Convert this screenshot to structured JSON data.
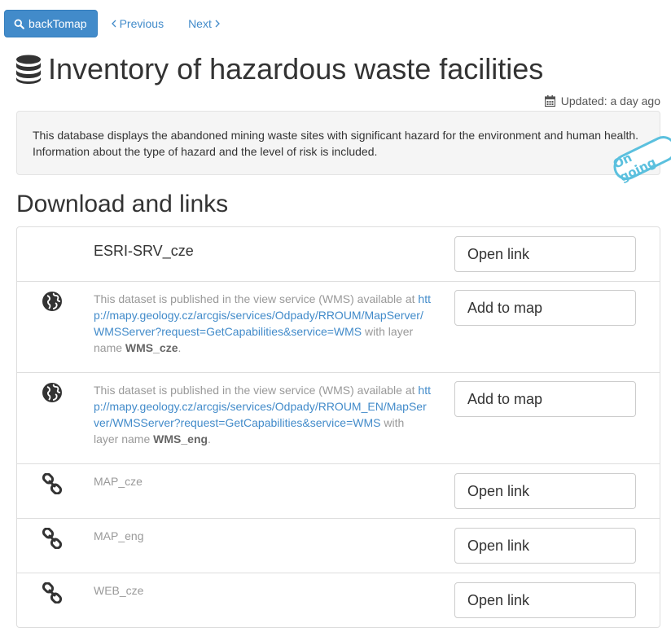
{
  "nav": {
    "back_label": "backTomap",
    "previous_label": "Previous",
    "next_label": "Next"
  },
  "title": "Inventory of hazardous waste facilities",
  "updated": "Updated: a day ago",
  "abstract": "This database displays the abandoned mining waste sites with significant hazard for the environment and human health. Information about the type of hazard and the level of risk is included.",
  "status_badge": "On going",
  "section_title": "Download and links",
  "links": [
    {
      "icon": "database-link",
      "name": "ESRI-SRV_cze",
      "button": "Open link"
    },
    {
      "icon": "globe-icon",
      "desc_prefix": "This dataset is published in the view service (WMS) available at",
      "url": "http://mapy.geology.cz/arcgis/services/Odpady/RROUM/MapServer/WMSServer?request=GetCapabilities&service=WMS",
      "desc_middle": "with layer name",
      "layer": "WMS_cze",
      "button": "Add to map"
    },
    {
      "icon": "globe-icon",
      "desc_prefix": "This dataset is published in the view service (WMS) available at",
      "url": "http://mapy.geology.cz/arcgis/services/Odpady/RROUM_EN/MapServer/WMSServer?request=GetCapabilities&service=WMS",
      "desc_middle": "with layer name",
      "layer": "WMS_eng",
      "button": "Add to map"
    },
    {
      "icon": "link-icon",
      "name": "MAP_cze",
      "button": "Open link"
    },
    {
      "icon": "link-icon",
      "name": "MAP_eng",
      "button": "Open link"
    },
    {
      "icon": "link-icon",
      "name": "WEB_cze",
      "button": "Open link"
    }
  ],
  "colors": {
    "primary": "#428bca",
    "badge": "#5bc0de",
    "muted_text": "#999999"
  }
}
